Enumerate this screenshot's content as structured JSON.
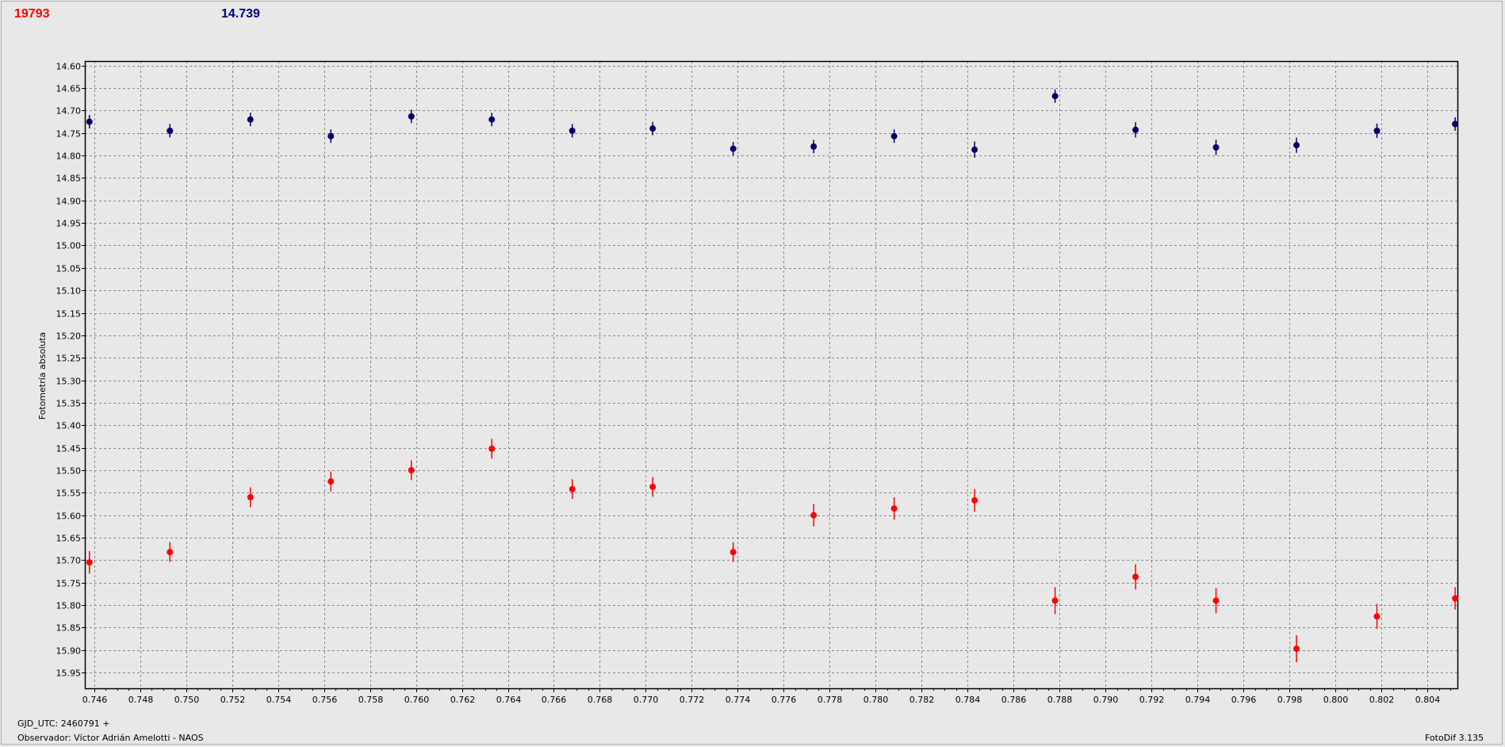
{
  "header": {
    "red_label": "19793",
    "blue_label": "14.739"
  },
  "footer": {
    "gjd": "GJD_UTC: 2460791 +",
    "observer": "Observador: Víctor Adrián Amelotti - NAOS",
    "version": "FotoDif 3.135"
  },
  "colors": {
    "red_series": "#ff0000",
    "blue_series": "#000066",
    "grid": "#888888",
    "background": "#e8e8e8"
  },
  "chart_data": {
    "type": "scatter",
    "ylabel": "Fotometría absoluta",
    "xlabel": "",
    "xlim": [
      0.7456,
      0.8053
    ],
    "ylim": [
      15.985,
      14.59
    ],
    "y_inverted": true,
    "grid": true,
    "x_ticks": [
      "0.746",
      "0.748",
      "0.750",
      "0.752",
      "0.754",
      "0.756",
      "0.758",
      "0.760",
      "0.762",
      "0.764",
      "0.766",
      "0.768",
      "0.770",
      "0.772",
      "0.774",
      "0.776",
      "0.778",
      "0.780",
      "0.782",
      "0.784",
      "0.786",
      "0.788",
      "0.790",
      "0.792",
      "0.794",
      "0.796",
      "0.798",
      "0.800",
      "0.802",
      "0.804"
    ],
    "y_ticks": [
      "14.60",
      "14.65",
      "14.70",
      "14.75",
      "14.80",
      "14.85",
      "14.90",
      "14.95",
      "15.00",
      "15.05",
      "15.10",
      "15.15",
      "15.20",
      "15.25",
      "15.30",
      "15.35",
      "15.40",
      "15.45",
      "15.50",
      "15.55",
      "15.60",
      "15.65",
      "15.70",
      "15.75",
      "15.80",
      "15.85",
      "15.90",
      "15.95"
    ],
    "series": [
      {
        "color": "#000066",
        "x": [
          0.7458,
          0.7493,
          0.7528,
          0.7563,
          0.7598,
          0.7633,
          0.7668,
          0.7703,
          0.7738,
          0.7773,
          0.7808,
          0.7843,
          0.7878,
          0.7913,
          0.7948,
          0.7983,
          0.8018,
          0.8052
        ],
        "y": [
          14.725,
          14.745,
          14.72,
          14.757,
          14.713,
          14.72,
          14.745,
          14.74,
          14.785,
          14.78,
          14.757,
          14.787,
          14.668,
          14.743,
          14.782,
          14.777,
          14.745,
          14.73
        ],
        "err": [
          0.015,
          0.015,
          0.015,
          0.015,
          0.015,
          0.015,
          0.015,
          0.015,
          0.015,
          0.015,
          0.015,
          0.018,
          0.015,
          0.017,
          0.017,
          0.017,
          0.016,
          0.015
        ]
      },
      {
        "color": "#ff0000",
        "x": [
          0.7458,
          0.7493,
          0.7528,
          0.7563,
          0.7598,
          0.7633,
          0.7668,
          0.7703,
          0.7738,
          0.7773,
          0.7808,
          0.7843,
          0.7878,
          0.7913,
          0.7948,
          0.7983,
          0.8018,
          0.8052
        ],
        "y": [
          15.705,
          15.682,
          15.56,
          15.525,
          15.5,
          15.452,
          15.542,
          15.537,
          15.682,
          15.6,
          15.585,
          15.567,
          15.79,
          15.737,
          15.79,
          15.897,
          15.825,
          15.785
        ],
        "err": [
          0.025,
          0.022,
          0.022,
          0.022,
          0.022,
          0.022,
          0.022,
          0.022,
          0.022,
          0.025,
          0.025,
          0.025,
          0.03,
          0.028,
          0.028,
          0.03,
          0.028,
          0.025
        ]
      }
    ]
  }
}
